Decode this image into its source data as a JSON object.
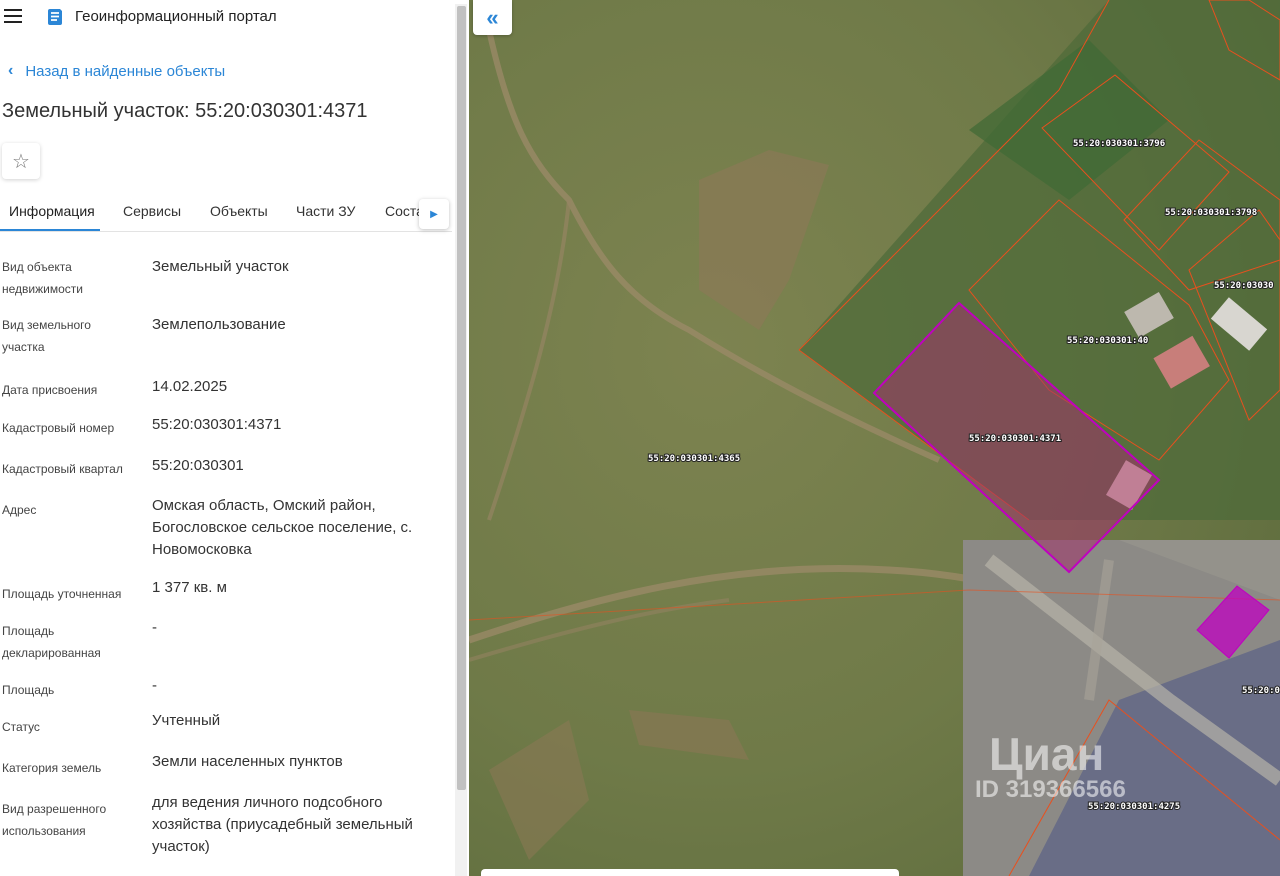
{
  "app": {
    "title": "Геоинформационный портал"
  },
  "nav": {
    "back_label": "Назад в найденные объекты"
  },
  "object": {
    "title": "Земельный участок: 55:20:030301:4371"
  },
  "tabs": [
    {
      "label": "Информация"
    },
    {
      "label": "Сервисы"
    },
    {
      "label": "Объекты"
    },
    {
      "label": "Части ЗУ"
    },
    {
      "label": "Соста"
    }
  ],
  "properties": [
    {
      "label": "Вид объекта недвижимости",
      "value": "Земельный участок"
    },
    {
      "label": "Вид земельного участка",
      "value": "Землепользование"
    },
    {
      "label": "Дата присвоения",
      "value": "14.02.2025"
    },
    {
      "label": "Кадастровый номер",
      "value": "55:20:030301:4371"
    },
    {
      "label": "Кадастровый квартал",
      "value": "55:20:030301"
    },
    {
      "label": "Адрес",
      "value": "Омская область, Омский район, Богословское сельское поселение, с. Новомосковка"
    },
    {
      "label": "Площадь уточненная",
      "value": "1 377 кв. м"
    },
    {
      "label": "Площадь декларированная",
      "value": "-"
    },
    {
      "label": "Площадь",
      "value": "-"
    },
    {
      "label": "Статус",
      "value": "Учтенный"
    },
    {
      "label": "Категория земель",
      "value": "Земли населенных пунктов"
    },
    {
      "label": "Вид разрешенного использования",
      "value": "для ведения личного подсобного хозяйства (приусадебный земельный участок)"
    }
  ],
  "map": {
    "parcel_labels": [
      "55:20:030301:3796",
      "55:20:030301:3798",
      "55:20:03030",
      "55:20:030301:40",
      "55:20:030301:4371",
      "55:20:030301:4365",
      "55:20:0",
      "55:20:030301:4275"
    ],
    "watermark_brand": "Циан",
    "watermark_id": "ID 319366566"
  },
  "colors": {
    "accent": "#2b86d6",
    "selected_parcel": "#c000c0",
    "parcel_border": "#e8501e"
  }
}
